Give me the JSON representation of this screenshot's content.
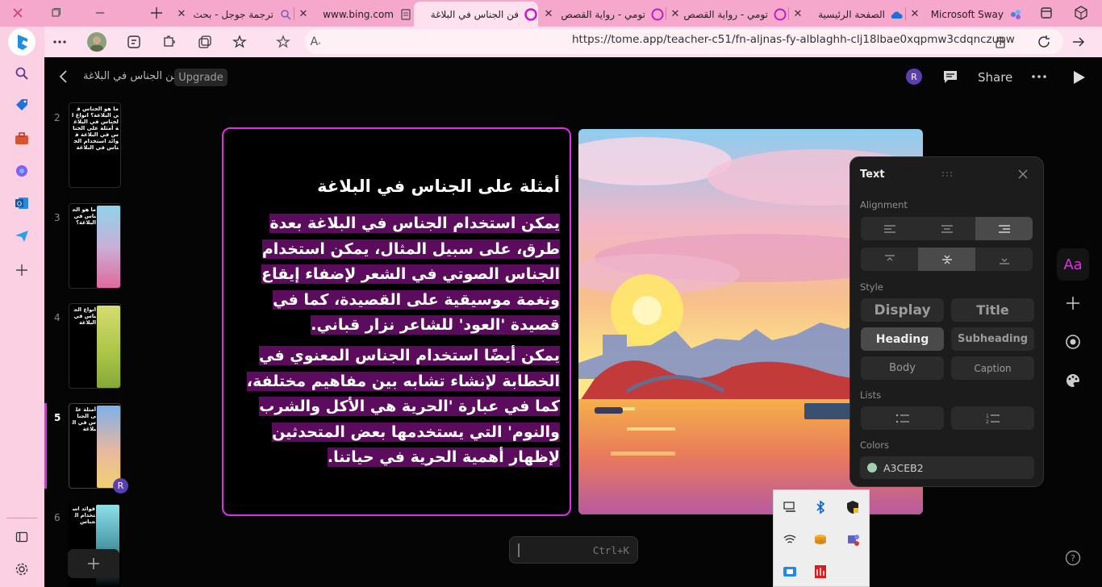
{
  "browser": {
    "tabs": [
      {
        "title": "ترجمة جوجل - بحث",
        "favicon": "search-icon",
        "active": false
      },
      {
        "title": "www.bing.com",
        "favicon": "document-icon",
        "active": false
      },
      {
        "title": "فن الجناس في البلاغة",
        "favicon": "tome-icon",
        "active": true
      },
      {
        "title": "تومي - رواية القصص",
        "favicon": "tome-icon",
        "active": false
      },
      {
        "title": "تومي - رواية القصص",
        "favicon": "tome-icon",
        "active": false
      },
      {
        "title": "الصفحة الرئيسية",
        "favicon": "onedrive-icon",
        "active": false
      },
      {
        "title": "Microsoft Sway",
        "favicon": "sway-icon",
        "active": false
      }
    ],
    "url": "https://tome.app/teacher-c51/fn-aljnas-fy-alblaghh-clj18lbae0xqpmw3cdqnczupw"
  },
  "app": {
    "doc_title": "فن الجناس في البلاغة",
    "upgrade_label": "Upgrade",
    "share_label": "Share",
    "avatar_initial": "R"
  },
  "thumbnails": [
    {
      "num": "2",
      "text": "ما هو الجناس في البلاغة؟ انواع الجناس في البلاغة أمثلة على الجناس في البلاغة فوائد استخدام الجناس في البلاغة"
    },
    {
      "num": "3",
      "text": "ما هو الجناس في البلاغة؟"
    },
    {
      "num": "4",
      "text": "انواع الجناس في البلاغة"
    },
    {
      "num": "5",
      "text": "أمثلة على الجناس في البلاغة"
    },
    {
      "num": "6",
      "text": "فوائد استخدام الجناس"
    }
  ],
  "slide": {
    "heading": "أمثلة على الجناس في البلاغة",
    "paragraph1": "يمكن استخدام الجناس في البلاغة بعدة طرق، على سبيل المثال، يمكن استخدام الجناس الصوتي في الشعر لإضفاء إيقاع ونغمة موسيقية على القصيدة، كما في قصيدة 'العود' للشاعر نزار قباني.",
    "paragraph2": "يمكن أيضًا استخدام الجناس المعنوي في الخطابة لإنشاء تشابه بين مفاهيم مختلفة، كما في عبارة 'الحرية هي الأكل والشرب والنوم' التي يستخدمها بعض المتحدثين لإظهار أهمية الحرية في حياتنا."
  },
  "text_panel": {
    "title": "Text",
    "alignment_label": "Alignment",
    "style_label": "Style",
    "styles": [
      "Display",
      "Title",
      "Heading",
      "Subheading",
      "Body",
      "Caption"
    ],
    "selected_style": "Heading",
    "lists_label": "Lists",
    "colors_label": "Colors",
    "color_value": "A3CEB2",
    "color_hex": "#a3ceb2"
  },
  "command_bar": {
    "shortcut": "Ctrl+K"
  },
  "theme": {
    "accent": "#e02be8",
    "highlight": "#5c0c5c",
    "tab_bar": "#f6a8cc"
  }
}
